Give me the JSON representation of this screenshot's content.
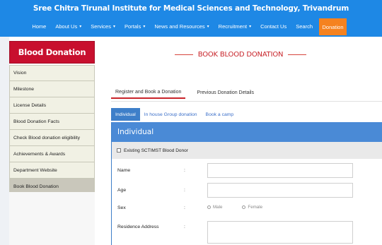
{
  "header": {
    "site_title": "Sree Chitra Tirunal Institute for Medical Sciences and Technology, Trivandrum",
    "nav": [
      {
        "label": "Home",
        "dropdown": false
      },
      {
        "label": "About Us",
        "dropdown": true
      },
      {
        "label": "Services",
        "dropdown": true
      },
      {
        "label": "Portals",
        "dropdown": true
      },
      {
        "label": "News and Resources",
        "dropdown": true
      },
      {
        "label": "Recruitment",
        "dropdown": true
      },
      {
        "label": "Contact Us",
        "dropdown": false
      },
      {
        "label": "Search",
        "dropdown": false
      }
    ],
    "donation_label": "Donation",
    "colors": {
      "bar": "#1e88e5",
      "donation": "#f5821f"
    }
  },
  "sidebar": {
    "title": "Blood Donation",
    "items": [
      {
        "label": "Vision"
      },
      {
        "label": "Milestone"
      },
      {
        "label": "License Details"
      },
      {
        "label": "Blood Donation Facts"
      },
      {
        "label": "Check Blood donation eligibility"
      },
      {
        "label": "Achievements & Awards"
      },
      {
        "label": "Department Website"
      },
      {
        "label": "Book Blood Donation"
      }
    ],
    "active_index": 7,
    "colors": {
      "header": "#c8102e"
    }
  },
  "main": {
    "page_title": "BOOK BLOOD DONATION",
    "tabs": [
      {
        "label": "Register and Book a Donation",
        "active": true
      },
      {
        "label": "Previous Donation Details",
        "active": false
      }
    ],
    "subtabs": [
      {
        "label": "Individual",
        "active": true
      },
      {
        "label": "In house Group donation",
        "active": false
      },
      {
        "label": "Book a camp",
        "active": false
      }
    ],
    "panel_title": "Individual",
    "existing_donor_label": "Existing SCTIMST Blood Donor",
    "form": {
      "name_label": "Name",
      "age_label": "Age",
      "sex_label": "Sex",
      "sex_options": [
        "Male",
        "Female"
      ],
      "address_label": "Residence Address",
      "colon": ":"
    }
  }
}
